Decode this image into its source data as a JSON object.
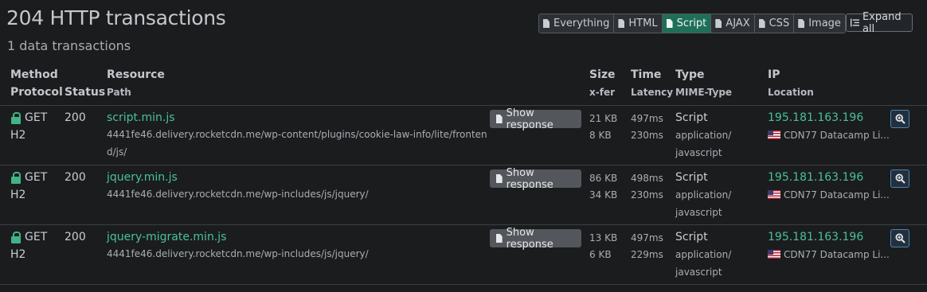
{
  "header": {
    "title": "204 HTTP transactions",
    "subtitle": "1 data transactions"
  },
  "filters": [
    {
      "label": "Everything",
      "active": false
    },
    {
      "label": "HTML",
      "active": false
    },
    {
      "label": "Script",
      "active": true
    },
    {
      "label": "AJAX",
      "active": false
    },
    {
      "label": "CSS",
      "active": false
    },
    {
      "label": "Image",
      "active": false
    }
  ],
  "expand_label": "Expand all",
  "columns": {
    "method": "Method",
    "protocol": "Protocol",
    "status": "Status",
    "resource": "Resource",
    "path": "Path",
    "size": "Size",
    "xfer": "x-fer",
    "time": "Time",
    "latency": "Latency",
    "type": "Type",
    "mime": "MIME-Type",
    "ip": "IP",
    "location": "Location"
  },
  "show_response_label": "Show response",
  "rows": [
    {
      "method": "GET",
      "protocol": "H2",
      "status": "200",
      "name": "script.min.js",
      "path": "4441fe46.delivery.rocketcdn.me/wp-content/plugins/cookie-law-info/lite/frontend/js/",
      "size": "21 KB",
      "xfer": "8 KB",
      "time": "497ms",
      "latency": "230ms",
      "type": "Script",
      "mime1": "application/",
      "mime2": "javascript",
      "ip": "195.181.163.196",
      "location": "CDN77 Datacamp Li..."
    },
    {
      "method": "GET",
      "protocol": "H2",
      "status": "200",
      "name": "jquery.min.js",
      "path": "4441fe46.delivery.rocketcdn.me/wp-includes/js/jquery/",
      "size": "86 KB",
      "xfer": "34 KB",
      "time": "498ms",
      "latency": "230ms",
      "type": "Script",
      "mime1": "application/",
      "mime2": "javascript",
      "ip": "195.181.163.196",
      "location": "CDN77 Datacamp Li..."
    },
    {
      "method": "GET",
      "protocol": "H2",
      "status": "200",
      "name": "jquery-migrate.min.js",
      "path": "4441fe46.delivery.rocketcdn.me/wp-includes/js/jquery/",
      "size": "13 KB",
      "xfer": "6 KB",
      "time": "497ms",
      "latency": "229ms",
      "type": "Script",
      "mime1": "application/",
      "mime2": "javascript",
      "ip": "195.181.163.196",
      "location": "CDN77 Datacamp Li..."
    }
  ],
  "colors": {
    "accent": "#48c196",
    "active_filter": "#1f6e58",
    "background": "#1b1c1e"
  }
}
